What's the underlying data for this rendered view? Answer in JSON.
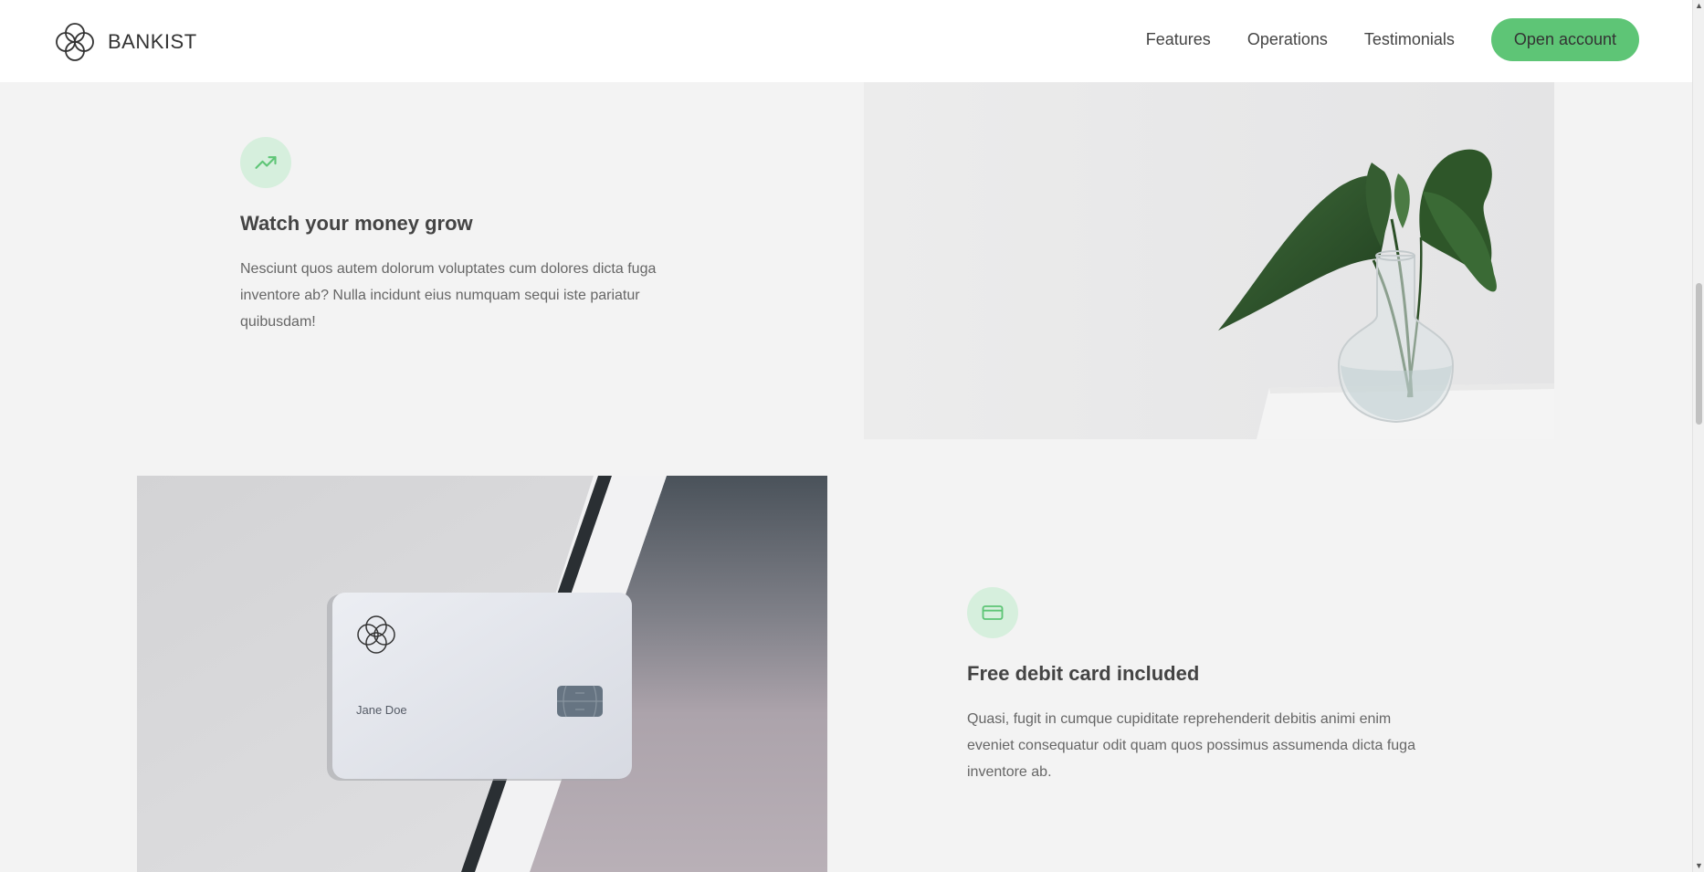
{
  "header": {
    "brand": "BANKIST",
    "nav": [
      "Features",
      "Operations",
      "Testimonials"
    ],
    "cta": "Open account"
  },
  "features": [
    {
      "icon": "trending-up-icon",
      "title": "Watch your money grow",
      "body": "Nesciunt quos autem dolorum voluptates cum dolores dicta fuga inventore ab? Nulla incidunt eius numquam sequi iste pariatur quibusdam!"
    },
    {
      "icon": "credit-card-icon",
      "title": "Free debit card included",
      "body": "Quasi, fugit in cumque cupiditate reprehenderit debitis animi enim eveniet consequatur odit quam quos possimus assumenda dicta fuga inventore ab."
    }
  ],
  "card_image": {
    "holder_name": "Jane Doe"
  },
  "colors": {
    "accent": "#5ec576",
    "icon_bg": "#d6efdd",
    "background": "#f3f3f3"
  }
}
